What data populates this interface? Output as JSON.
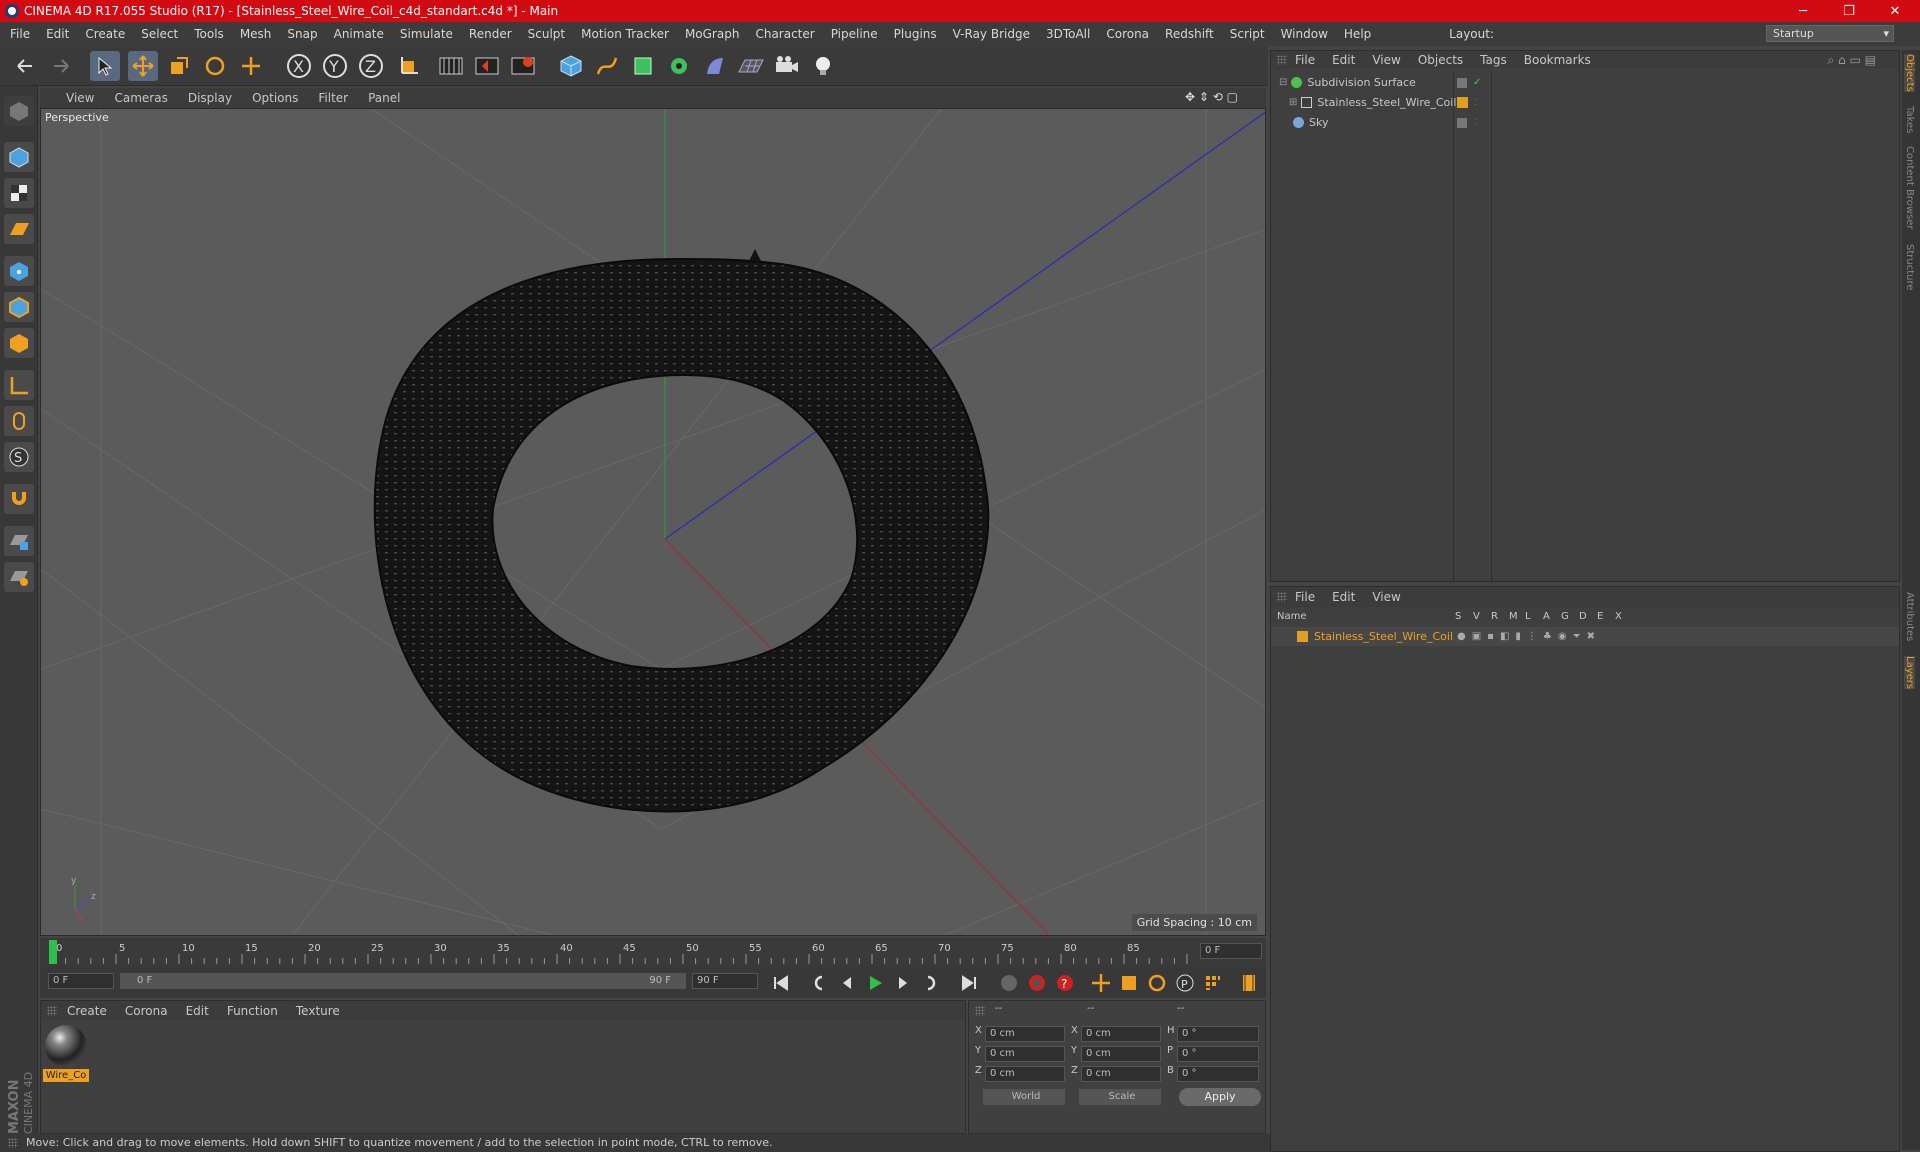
{
  "window": {
    "title": "CINEMA 4D R17.055 Studio (R17) - [Stainless_Steel_Wire_Coil_c4d_standart.c4d *] - Main",
    "controls": [
      "─",
      "❐",
      "✕"
    ]
  },
  "menubar": {
    "items": [
      "File",
      "Edit",
      "Create",
      "Select",
      "Tools",
      "Mesh",
      "Snap",
      "Animate",
      "Simulate",
      "Render",
      "Sculpt",
      "Motion Tracker",
      "MoGraph",
      "Character",
      "Pipeline",
      "Plugins",
      "V-Ray Bridge",
      "3DToAll",
      "Corona",
      "Redshift",
      "Script",
      "Window",
      "Help"
    ],
    "layout_label": "Layout:",
    "layout_value": "Startup"
  },
  "viewport": {
    "menu": [
      "View",
      "Cameras",
      "Display",
      "Options",
      "Filter",
      "Panel"
    ],
    "label": "Perspective",
    "grid_spacing": "Grid Spacing : 10 cm"
  },
  "timeline": {
    "ticks": [
      "0",
      "5",
      "10",
      "15",
      "20",
      "25",
      "30",
      "35",
      "40",
      "45",
      "50",
      "55",
      "60",
      "65",
      "70",
      "75",
      "80",
      "85",
      "90"
    ],
    "current": "0 F",
    "start": "0 F",
    "range_start": "0 F",
    "range_end": "90 F",
    "end": "90 F"
  },
  "materials": {
    "menu": [
      "Create",
      "Corona",
      "Edit",
      "Function",
      "Texture"
    ],
    "items": [
      {
        "label": "Wire_Co"
      }
    ]
  },
  "coords": {
    "header": [
      "--",
      "--",
      "--"
    ],
    "rows": [
      {
        "a": "X",
        "v1": "0 cm",
        "b": "X",
        "v2": "0 cm",
        "c": "H",
        "v3": "0 °"
      },
      {
        "a": "Y",
        "v1": "0 cm",
        "b": "Y",
        "v2": "0 cm",
        "c": "P",
        "v3": "0 °"
      },
      {
        "a": "Z",
        "v1": "0 cm",
        "b": "Z",
        "v2": "0 cm",
        "c": "B",
        "v3": "0 °"
      }
    ],
    "world": "World",
    "scale": "Scale",
    "apply": "Apply"
  },
  "objects": {
    "menu": [
      "File",
      "Edit",
      "View",
      "Objects",
      "Tags",
      "Bookmarks"
    ],
    "items": [
      {
        "name": "Subdivision Surface",
        "color": "#4ec24e"
      },
      {
        "name": "Stainless_Steel_Wire_Coil",
        "color": "#e0a020"
      },
      {
        "name": "Sky",
        "color": "#7aa7d8"
      }
    ]
  },
  "layers": {
    "menu": [
      "File",
      "Edit",
      "View"
    ],
    "columns": [
      "Name",
      "S",
      "V",
      "R",
      "M",
      "L",
      "A",
      "G",
      "D",
      "E",
      "X"
    ],
    "items": [
      {
        "name": "Stainless_Steel_Wire_Coil",
        "color": "#e0a020"
      }
    ]
  },
  "side_tabs": [
    "Objects",
    "Takes",
    "Content Browser",
    "Structure",
    "Attributes",
    "Layers"
  ],
  "status": "Move: Click and drag to move elements. Hold down SHIFT to quantize movement / add to the selection in point mode, CTRL to remove.",
  "brand": "MAXON CINEMA 4D"
}
